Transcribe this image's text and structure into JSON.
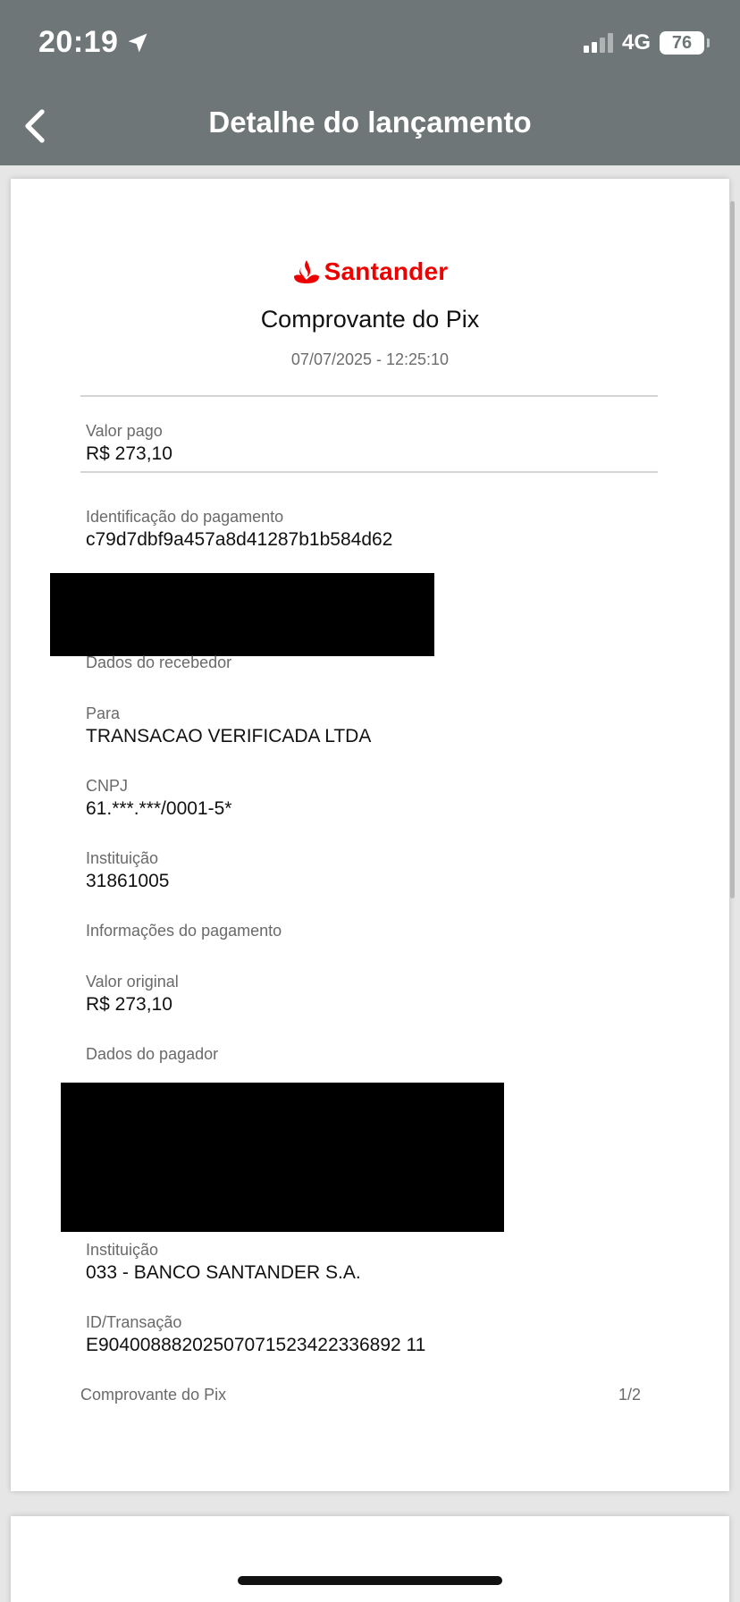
{
  "status_bar": {
    "time": "20:19",
    "network": "4G",
    "battery": "76"
  },
  "nav": {
    "title": "Detalhe do lançamento"
  },
  "receipt": {
    "brand": "Santander",
    "title": "Comprovante do Pix",
    "datetime": "07/07/2025 - 12:25:10",
    "valor_pago": {
      "label": "Valor pago",
      "value": "R$ 273,10"
    },
    "identificacao": {
      "label": "Identificação do pagamento",
      "value": "c79d7dbf9a457a8d41287b1b584d62"
    },
    "dados_recebedor": "Dados do recebedor",
    "para": {
      "label": "Para",
      "value": "TRANSACAO VERIFICADA LTDA"
    },
    "cnpj": {
      "label": "CNPJ",
      "value": "61.***.***/0001-5*"
    },
    "instituicao_recebedor": {
      "label": "Instituição",
      "value": "31861005"
    },
    "informacoes_pagamento": "Informações do pagamento",
    "valor_original": {
      "label": "Valor original",
      "value": "R$ 273,10"
    },
    "dados_pagador": "Dados do pagador",
    "instituicao_pagador": {
      "label": "Instituição",
      "value": "033 - BANCO SANTANDER S.A."
    },
    "id_transacao": {
      "label": "ID/Transação",
      "value": "E90400888202507071523422336892 11"
    },
    "footer_title": "Comprovante do Pix",
    "page_indicator": "1/2"
  },
  "colors": {
    "header_bg": "#6f7677",
    "brand_red": "#ec0000"
  }
}
